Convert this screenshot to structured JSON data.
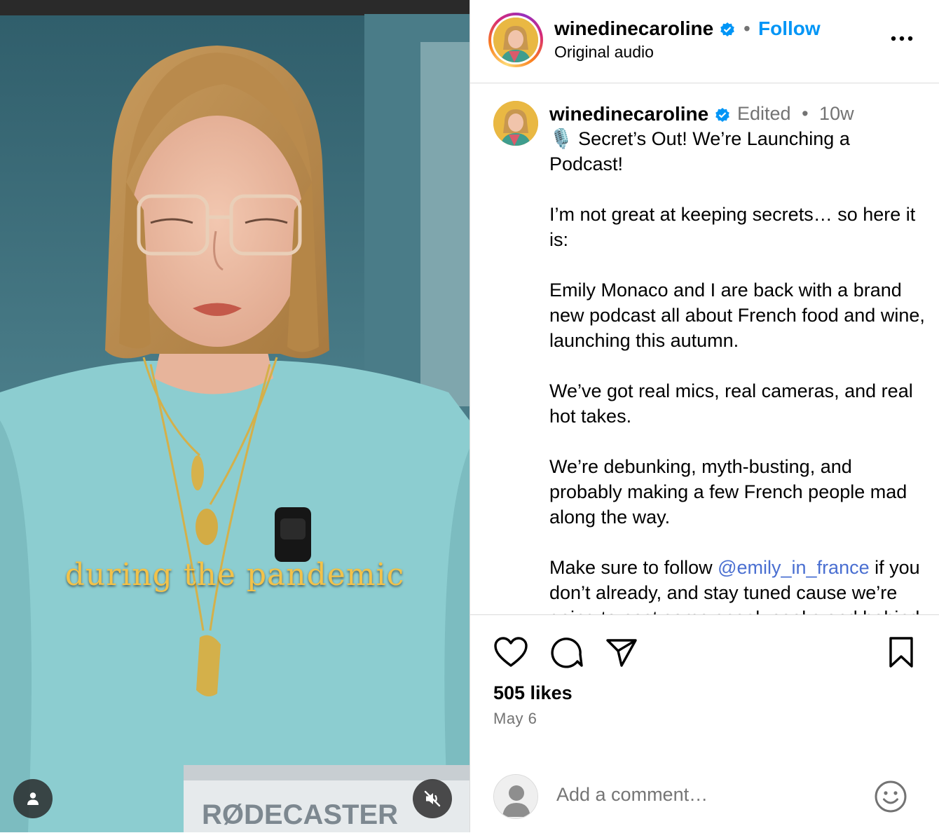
{
  "media": {
    "caption_overlay": "during the pandemic",
    "box_text": "RØDECASTER",
    "user_button_icon": "user-tag-icon",
    "mute_button_icon": "speaker-muted-icon"
  },
  "header": {
    "username": "winedinecaroline",
    "follow_label": "Follow",
    "separator": "•",
    "audio_label": "Original audio",
    "more_icon": "more-horizontal-icon"
  },
  "caption": {
    "username": "winedinecaroline",
    "edited_label": "Edited",
    "separator": "•",
    "age": "10w",
    "emoji": "🎙️",
    "title": " Secret’s Out! We’re Launching a Podcast!",
    "para1": "I’m not great at keeping secrets… so here it is:",
    "para2": "Emily Monaco and I are back with a brand new podcast all about French food and wine, launching this autumn.",
    "para3": "We’ve got real mics, real cameras, and real hot takes.",
    "para4": "We’re debunking, myth-busting, and probably making a few French people mad along the way.",
    "para5_before": "Make sure to follow ",
    "para5_mention": "@emily_in_france",
    "para5_after": " if you don’t already, and stay tuned cause we’re going to post some sneak peeks and behind the scenes content."
  },
  "actions": {
    "like_icon": "heart-icon",
    "comment_icon": "comment-icon",
    "share_icon": "send-icon",
    "save_icon": "bookmark-icon",
    "likes": "505 likes",
    "date": "May 6"
  },
  "comment_box": {
    "placeholder": "Add a comment…",
    "emoji_icon": "smiley-icon"
  },
  "colors": {
    "accent": "#0095f6",
    "mention": "#4a6fd1",
    "muted": "#737373",
    "caption_overlay": "#f2c24a",
    "sweater": "#8ccdd0"
  }
}
